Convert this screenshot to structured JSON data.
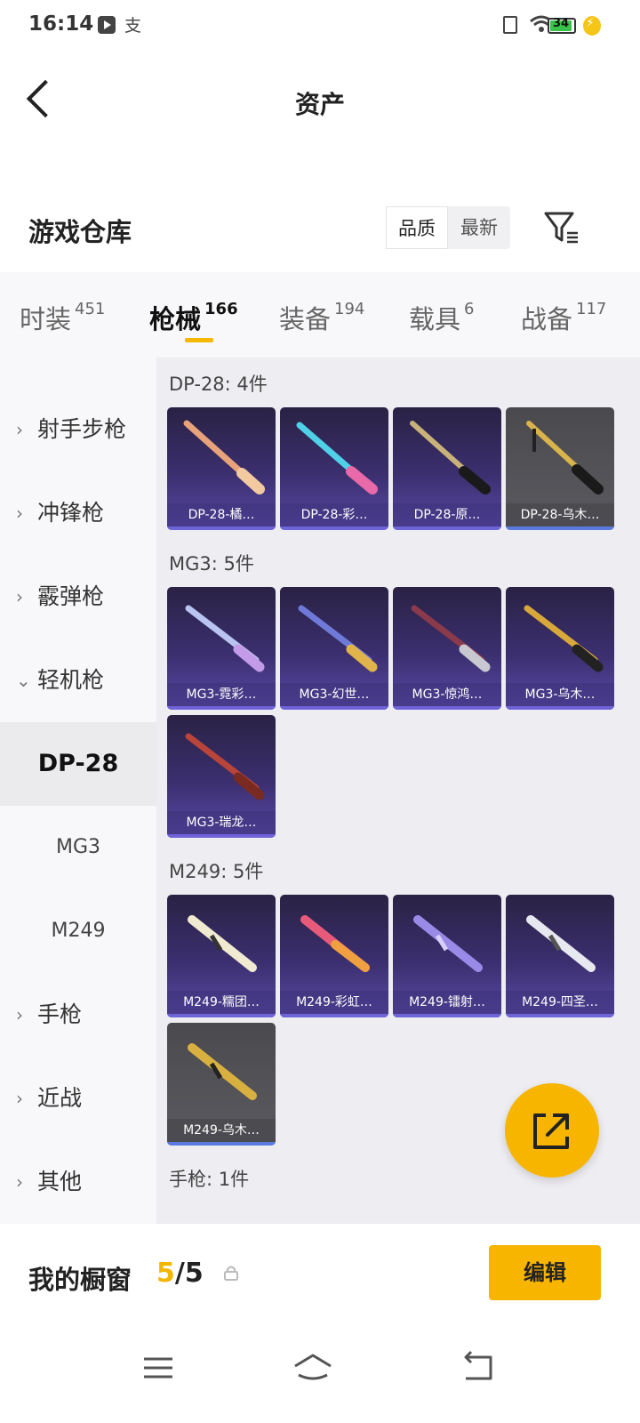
{
  "status_bar": {
    "time": "16:14",
    "alipay_icon": "支",
    "battery": "34"
  },
  "header": {
    "title": "资产",
    "back_icon": "back-arrow-icon"
  },
  "warehouse": {
    "title": "游戏仓库",
    "sort_options": [
      "品质",
      "最新"
    ],
    "active_sort": "品质"
  },
  "tabs": [
    {
      "label": "时装",
      "count": "451"
    },
    {
      "label": "枪械",
      "count": "166",
      "active": true
    },
    {
      "label": "装备",
      "count": "194"
    },
    {
      "label": "载具",
      "count": "6"
    },
    {
      "label": "战备",
      "count": "117"
    }
  ],
  "sidebar": {
    "items": [
      {
        "label": "射手步枪",
        "chevron": "›"
      },
      {
        "label": "冲锋枪",
        "chevron": "›"
      },
      {
        "label": "霰弹枪",
        "chevron": "›"
      },
      {
        "label": "轻机枪",
        "chevron": "⌄"
      },
      {
        "label": "DP-28"
      },
      {
        "label": "MG3"
      },
      {
        "label": "M249"
      },
      {
        "label": "手枪",
        "chevron": "›"
      },
      {
        "label": "近战",
        "chevron": "›"
      },
      {
        "label": "其他",
        "chevron": "›"
      }
    ],
    "selected": "DP-28"
  },
  "groups": [
    {
      "title": "DP-28: 4件",
      "items": [
        "DP-28-橘…",
        "DP-28-彩…",
        "DP-28-原…",
        "DP-28-乌木…"
      ]
    },
    {
      "title": "MG3: 5件",
      "items": [
        "MG3-霓彩…",
        "MG3-幻世…",
        "MG3-惊鸿…",
        "MG3-乌木…",
        "MG3-瑞龙…"
      ]
    },
    {
      "title": "M249: 5件",
      "items": [
        "M249-糯团…",
        "M249-彩虹…",
        "M249-镭射…",
        "M249-四圣…",
        "M249-乌木…"
      ]
    },
    {
      "title": "手枪: 1件",
      "items": []
    }
  ],
  "colors": {
    "accent": "#f7b500",
    "card_purple": "#3b2f6f",
    "card_grey": "#55555a"
  },
  "bottom_bar": {
    "showcase_label": "我的橱窗",
    "showcase_current": "5",
    "showcase_total": "/5",
    "edit_label": "编辑"
  }
}
